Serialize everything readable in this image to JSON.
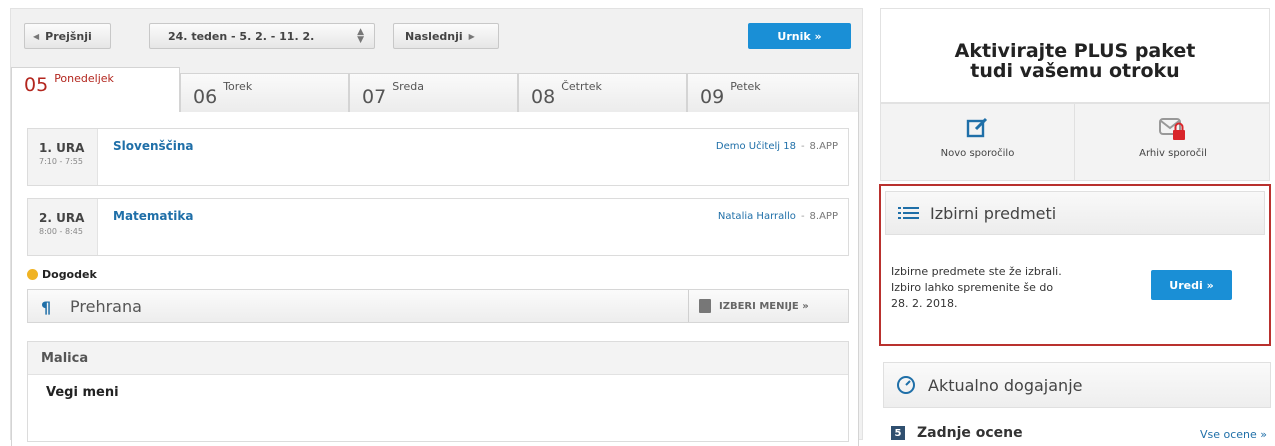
{
  "toolbar": {
    "prev_label": "Prejšnji",
    "week_label": "24. teden - 5. 2. - 11. 2.",
    "next_label": "Naslednji",
    "urnik_label": "Urnik »"
  },
  "tabs": [
    {
      "num": "05",
      "day": "Ponedeljek",
      "active": true
    },
    {
      "num": "06",
      "day": "Torek"
    },
    {
      "num": "07",
      "day": "Sreda"
    },
    {
      "num": "08",
      "day": "Četrtek"
    },
    {
      "num": "09",
      "day": "Petek"
    }
  ],
  "lessons": [
    {
      "ura": "1. URA",
      "time": "7:10 - 7:55",
      "subject": "Slovenščina",
      "teacher": "Demo Učitelj 18",
      "sep": "-",
      "class": "8.APP"
    },
    {
      "ura": "2. URA",
      "time": "8:00 - 8:45",
      "subject": "Matematika",
      "teacher": "Natalia Harrallo",
      "sep": "-",
      "class": "8.APP"
    }
  ],
  "event": {
    "label": "Dogodek"
  },
  "food": {
    "label": "Prehrana",
    "choose_label": "IZBERI MENIJE »"
  },
  "malica": {
    "title": "Malica",
    "menu": "Vegi meni"
  },
  "promo": {
    "line1": "Aktivirajte PLUS paket",
    "line2": "tudi vašemu otroku"
  },
  "messages": {
    "new_label": "Novo sporočilo",
    "archive_label": "Arhiv sporočil"
  },
  "izbirni": {
    "title": "Izbirni predmeti",
    "text": "Izbirne predmete ste že izbrali. Izbiro lahko spremenite še do 28. 2. 2018.",
    "button_label": "Uredi »"
  },
  "aktualno": {
    "title": "Aktualno dogajanje"
  },
  "zadnje": {
    "badge": "5",
    "title": "Zadnje ocene",
    "link": "Vse ocene »"
  },
  "colors": {
    "accent": "#1a8fd6",
    "active_day": "#b3261e",
    "highlight_border": "#b9312e",
    "link": "#1f6fa8"
  }
}
